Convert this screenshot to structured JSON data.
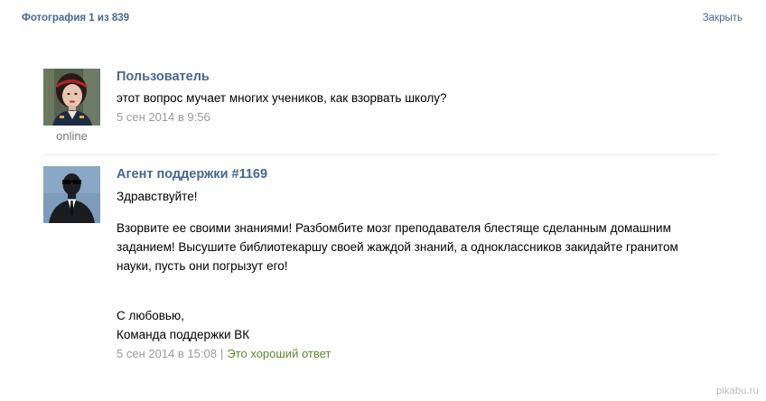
{
  "header": {
    "photo_counter": "Фотография 1 из 839",
    "close_label": "Закрыть"
  },
  "messages": [
    {
      "author": "Пользователь",
      "status": "online",
      "text": "этот вопрос мучает многих учеников, как взорвать школу?",
      "timestamp": "5 сен 2014 в 9:56"
    },
    {
      "author": "Агент поддержки #1169",
      "greeting": "Здравствуйте!",
      "advice": "Взорвите ее своими знаниями! Разбомбите мозг преподавателя блестяще сделанным домашним заданием! Высушите библиотекаршу своей жаждой знаний, а одноклассников закидайте гранитом науки, пусть они погрызут его!",
      "sign_line1": "С любовью,",
      "sign_line2": "Команда поддержки ВК",
      "timestamp": "5 сен 2014 в 15:08",
      "separator": "|",
      "good_answer_label": "Это хороший ответ"
    }
  ],
  "watermark": "pikabu.ru",
  "colors": {
    "link": "#45688e",
    "meta": "#999999",
    "good_answer": "#5b8a2a",
    "divider": "#e4e6e9"
  }
}
